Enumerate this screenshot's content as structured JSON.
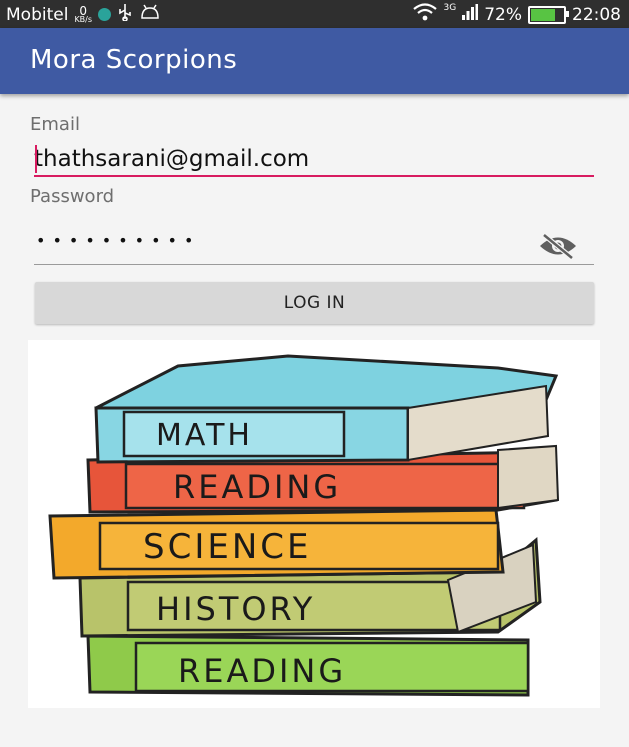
{
  "status_bar": {
    "carrier": "Mobitel",
    "speed_value": "0",
    "speed_unit": "KB/s",
    "network": "3G",
    "battery": "72%",
    "battery_level": 0.72,
    "time": "22:08"
  },
  "app_bar": {
    "title": "Mora Scorpions"
  },
  "login_form": {
    "email_label": "Email",
    "email_value": "thathsarani@gmail.com",
    "password_label": "Password",
    "password_masked": "••••••••••",
    "login_button": "LOG IN"
  },
  "books_illustration": {
    "books": [
      "MATH",
      "READING",
      "SCIENCE",
      "HISTORY",
      "READING"
    ]
  },
  "colors": {
    "app_bar": "#3f5aa3",
    "accent": "#d81b60",
    "button": "#d8d8d8"
  }
}
